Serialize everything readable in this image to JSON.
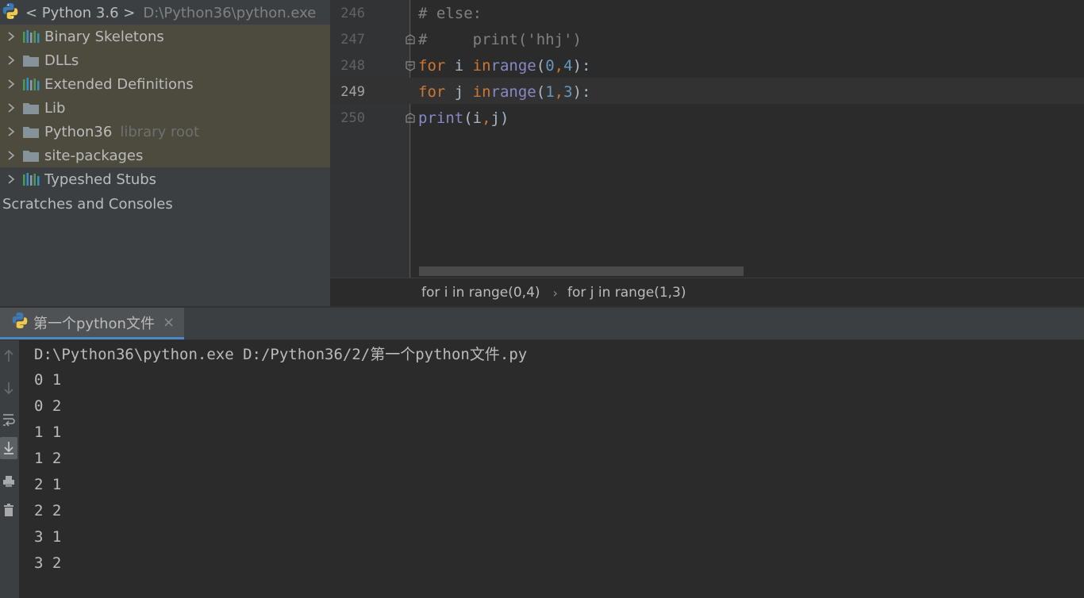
{
  "project_tree": {
    "sdk_label": "< Python 3.6 >",
    "sdk_path": "D:\\Python36\\python.exe",
    "items": [
      {
        "label": "Binary Skeletons",
        "icon": "library-bars-icon"
      },
      {
        "label": "DLLs",
        "icon": "folder-icon"
      },
      {
        "label": "Extended Definitions",
        "icon": "library-bars-icon"
      },
      {
        "label": "Lib",
        "icon": "folder-icon"
      },
      {
        "label": "Python36",
        "suffix": "library root",
        "icon": "folder-icon"
      },
      {
        "label": "site-packages",
        "icon": "folder-icon"
      },
      {
        "label": "Typeshed Stubs",
        "icon": "library-bars-icon"
      }
    ],
    "scratches": "Scratches and Consoles"
  },
  "editor": {
    "current_line": 249,
    "lines": [
      {
        "num": "246",
        "text": "# else:"
      },
      {
        "num": "247",
        "text": "#     print('hhj')"
      },
      {
        "num": "248",
        "text": "for i in range(0,4):"
      },
      {
        "num": "249",
        "text": "    for j in range(1,3):"
      },
      {
        "num": "250",
        "text": "     print(i,j)"
      }
    ]
  },
  "breadcrumb": {
    "items": [
      "for i in range(0,4)",
      "for j in range(1,3)"
    ],
    "separator": "›"
  },
  "run": {
    "tab_label": "第一个python文件",
    "command": "D:\\Python36\\python.exe D:/Python36/2/第一个python文件.py",
    "output": [
      "0 1",
      "0 2",
      "1 1",
      "1 2",
      "2 1",
      "2 2",
      "3 1",
      "3 2"
    ]
  },
  "colors": {
    "keyword": "#cc7832",
    "builtin": "#8888c6",
    "number": "#6897bb",
    "comment": "#808080",
    "highlight_row": "#4d4a3e"
  }
}
